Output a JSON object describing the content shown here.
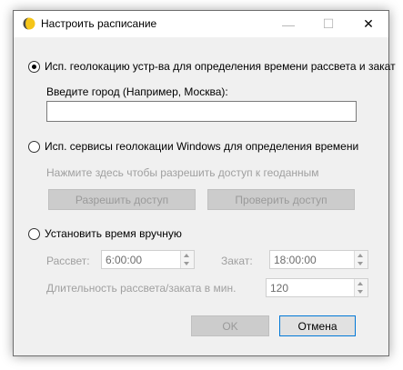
{
  "window": {
    "title": "Настроить расписание",
    "minimize_glyph": "—",
    "maximize_glyph": "☐",
    "close_glyph": "✕"
  },
  "options": {
    "geo_device_label": "Исп. геолокацию устр-ва для определения времени рассвета и закат",
    "geo_device_checked": true,
    "city_label": "Введите город (Например, Москва):",
    "city_value": "",
    "geo_windows_label": "Исп. сервисы геолокации Windows для определения времени",
    "geo_windows_checked": false,
    "geo_access_hint": "Нажмите здесь чтобы разрешить доступ к геоданным",
    "allow_access_button": "Разрешить доступ",
    "check_access_button": "Проверить доступ",
    "manual_label": "Установить время вручную",
    "manual_checked": false,
    "sunrise_label": "Рассвет:",
    "sunrise_value": "6:00:00",
    "sunset_label": "Закат:",
    "sunset_value": "18:00:00",
    "duration_label": "Длительность рассвета/заката в мин.",
    "duration_value": "120"
  },
  "footer": {
    "ok_label": "OK",
    "cancel_label": "Отмена"
  },
  "icons": {
    "app_icon": "half-moon-icon"
  },
  "colors": {
    "window_bg": "#f0f0f0",
    "disabled_text": "#a0a0a0",
    "focus_border": "#0078d7",
    "app_icon_yellow": "#f5c518"
  }
}
